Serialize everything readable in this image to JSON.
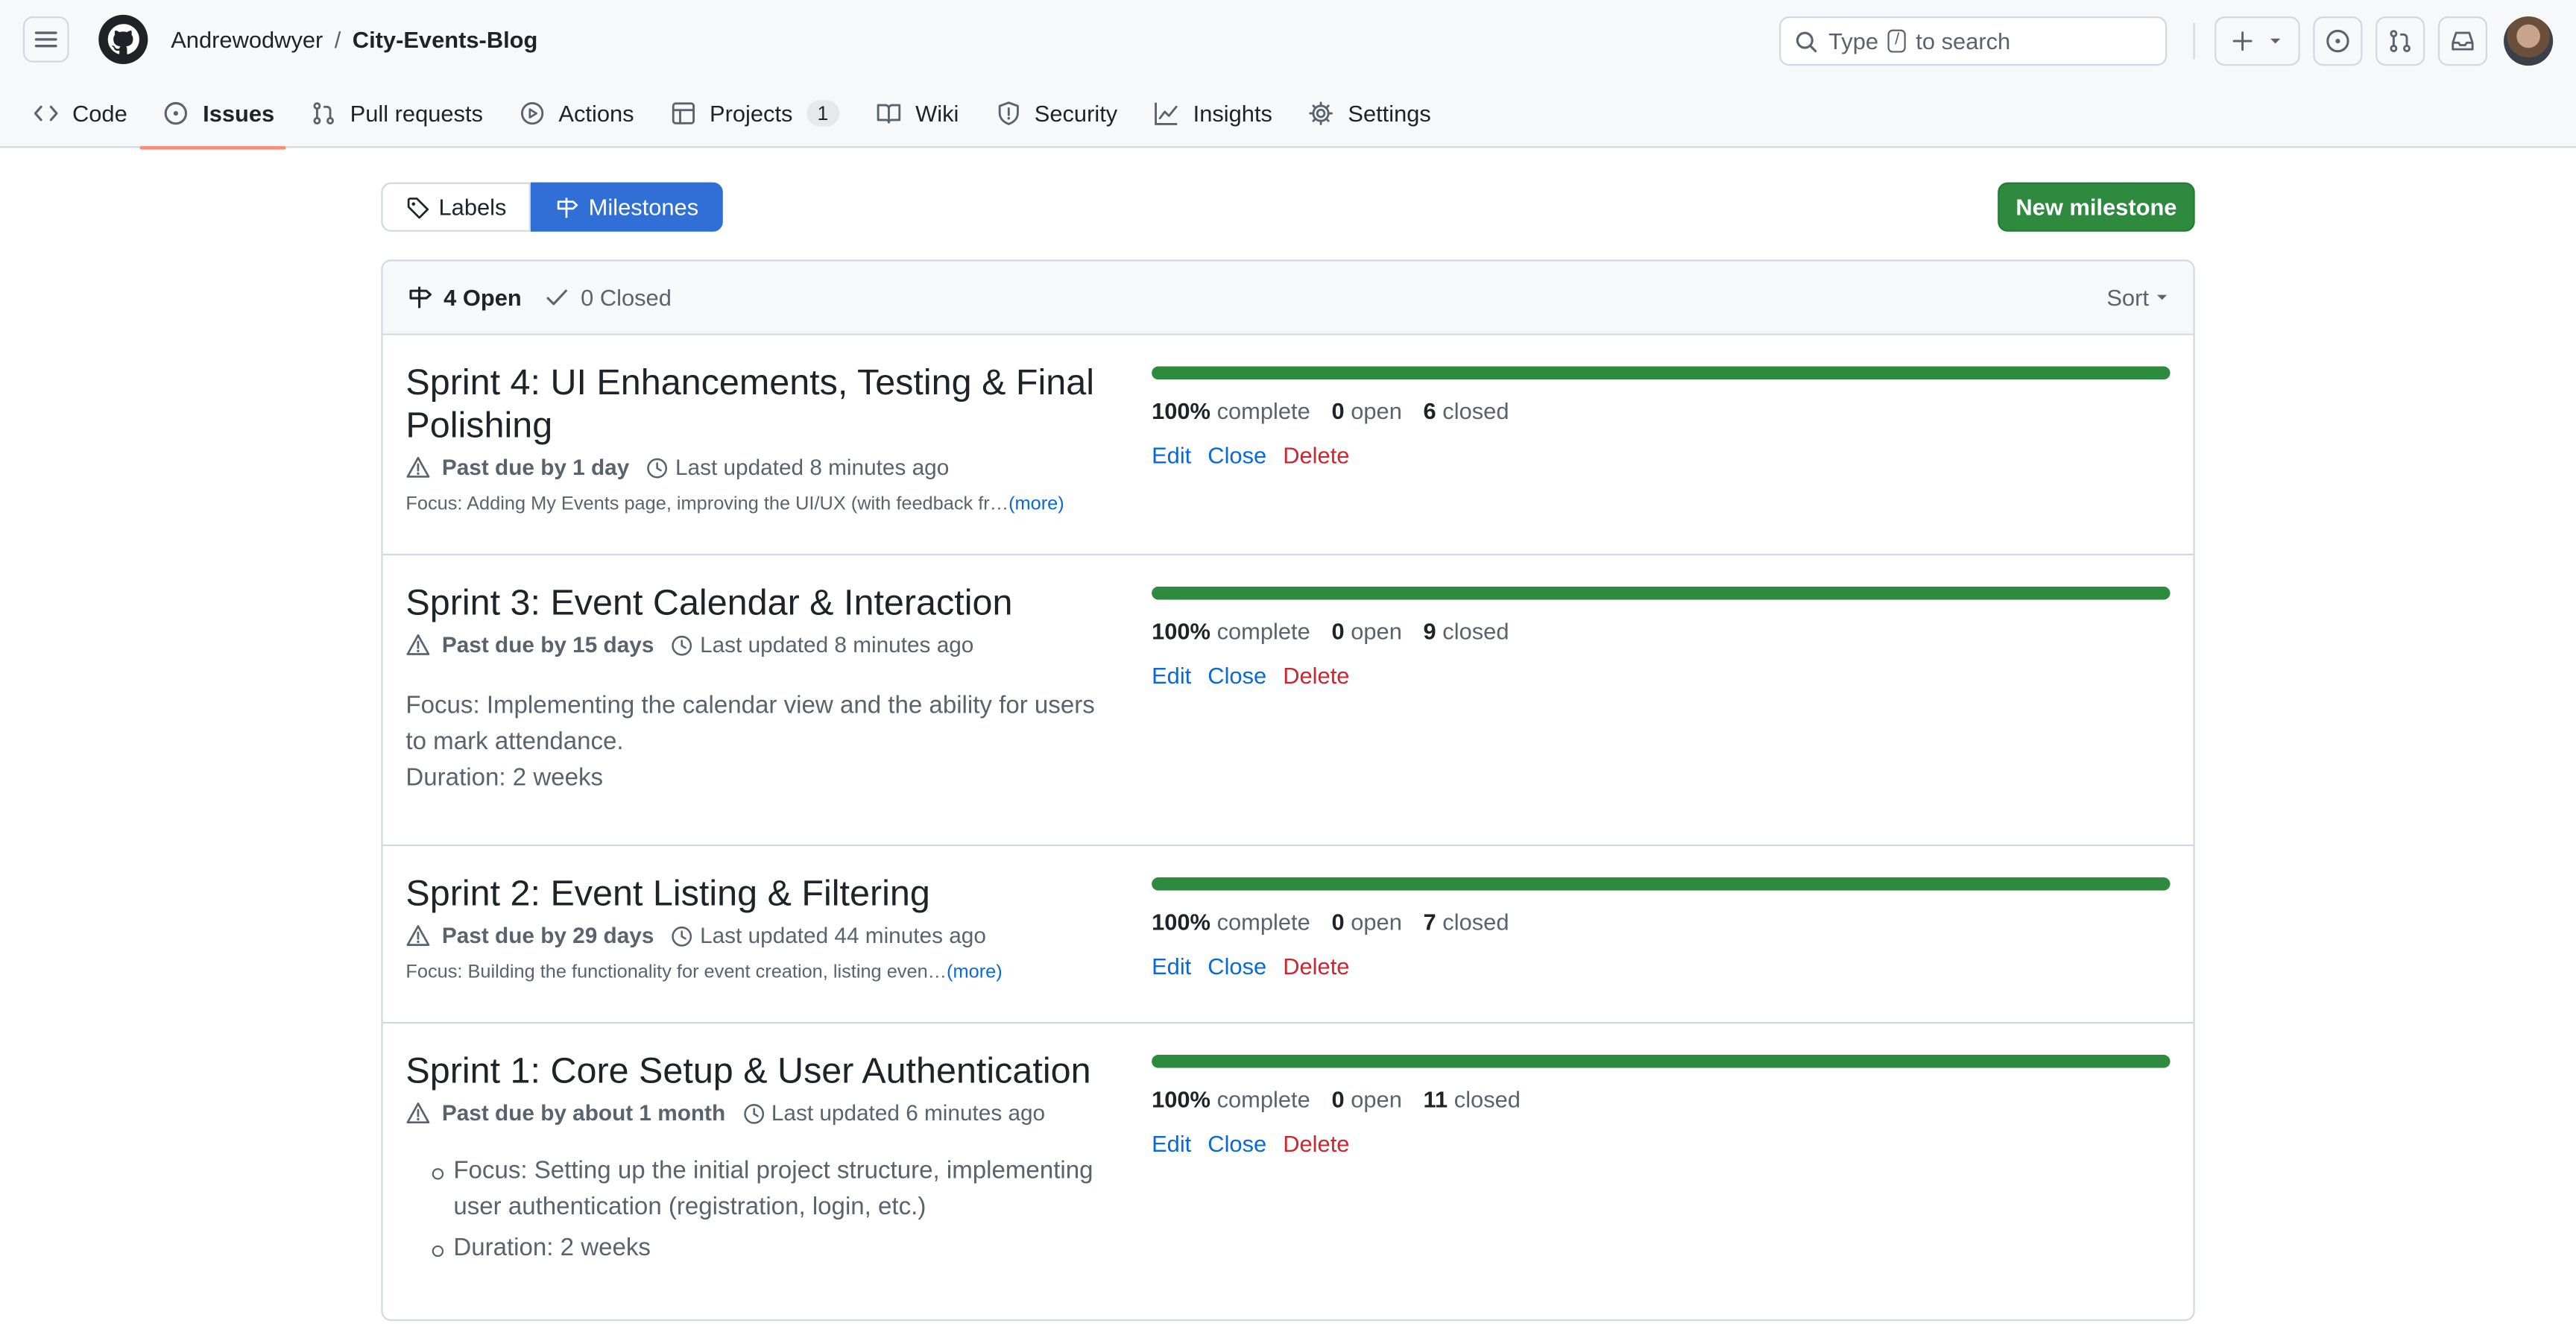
{
  "repo": {
    "owner": "Andrewodwyer",
    "separator": "/",
    "name": "City-Events-Blog"
  },
  "search": {
    "prefix": "Type",
    "key": "/",
    "suffix": "to search"
  },
  "tabs": [
    {
      "label": "Code"
    },
    {
      "label": "Issues"
    },
    {
      "label": "Pull requests"
    },
    {
      "label": "Actions"
    },
    {
      "label": "Projects",
      "count": "1"
    },
    {
      "label": "Wiki"
    },
    {
      "label": "Security"
    },
    {
      "label": "Insights"
    },
    {
      "label": "Settings"
    }
  ],
  "subnav": {
    "labels": "Labels",
    "milestones": "Milestones"
  },
  "new_milestone": "New milestone",
  "filter": {
    "open": "4 Open",
    "closed": "0 Closed",
    "sort": "Sort"
  },
  "milestones": [
    {
      "title": "Sprint 4: UI Enhancements, Testing & Final Polishing",
      "due": "Past due by 1 day",
      "updated": "Last updated 8 minutes ago",
      "desc": "Focus: Adding My Events page, improving the UI/UX (with feedback fr…",
      "more": "(more)",
      "percent": "100%",
      "percent_label": "complete",
      "open": "0",
      "open_label": "open",
      "closed": "6",
      "closed_label": "closed",
      "progress": 1.0
    },
    {
      "title": "Sprint 3: Event Calendar & Interaction",
      "due": "Past due by 15 days",
      "updated": "Last updated 8 minutes ago",
      "desc_line1": "Focus: Implementing the calendar view and the ability for users to mark attendance.",
      "desc_line2": "Duration: 2 weeks",
      "percent": "100%",
      "percent_label": "complete",
      "open": "0",
      "open_label": "open",
      "closed": "9",
      "closed_label": "closed",
      "progress": 1.0
    },
    {
      "title": "Sprint 2: Event Listing & Filtering",
      "due": "Past due by 29 days",
      "updated": "Last updated 44 minutes ago",
      "desc": "Focus: Building the functionality for event creation, listing even…",
      "more": "(more)",
      "percent": "100%",
      "percent_label": "complete",
      "open": "0",
      "open_label": "open",
      "closed": "7",
      "closed_label": "closed",
      "progress": 1.0
    },
    {
      "title": "Sprint 1: Core Setup & User Authentication",
      "due": "Past due by about 1 month",
      "updated": "Last updated 6 minutes ago",
      "list": [
        "Focus: Setting up the initial project structure, implementing user authentication (registration, login, etc.)",
        "Duration: 2 weeks"
      ],
      "percent": "100%",
      "percent_label": "complete",
      "open": "0",
      "open_label": "open",
      "closed": "11",
      "closed_label": "closed",
      "progress": 1.0
    }
  ],
  "actions": {
    "edit": "Edit",
    "close": "Close",
    "delete": "Delete"
  },
  "colors": {
    "accent": "#2f6fd6",
    "success": "#2d8a3e",
    "danger": "#d1242f",
    "link": "#0969da",
    "tab_underline": "#fd8c73"
  }
}
